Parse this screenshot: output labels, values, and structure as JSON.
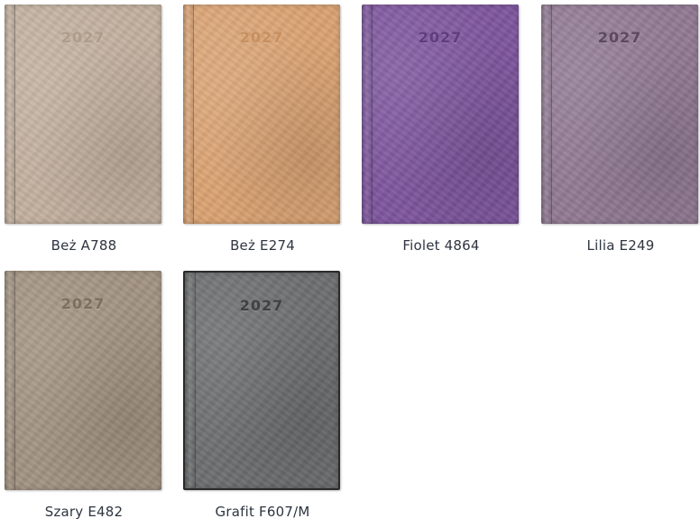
{
  "products": [
    {
      "year": "2027",
      "label": "Beż A788",
      "cover_color": "#c3b19f",
      "year_color": "#ad9c8a"
    },
    {
      "year": "2027",
      "label": "Beż E274",
      "cover_color": "#dba373",
      "year_color": "#c78f60"
    },
    {
      "year": "2027",
      "label": "Fiolet 4864",
      "cover_color": "#7e569e",
      "year_color": "#5f3d7d"
    },
    {
      "year": "2027",
      "label": "Lilia E249",
      "cover_color": "#927a94",
      "year_color": "#5d4661"
    },
    {
      "year": "2027",
      "label": "Szary E482",
      "cover_color": "#a29381",
      "year_color": "#7d6e5e"
    },
    {
      "year": "2027",
      "label": "Grafit F607/M",
      "cover_color": "#6c6e70",
      "year_color": "#3f4143"
    }
  ]
}
